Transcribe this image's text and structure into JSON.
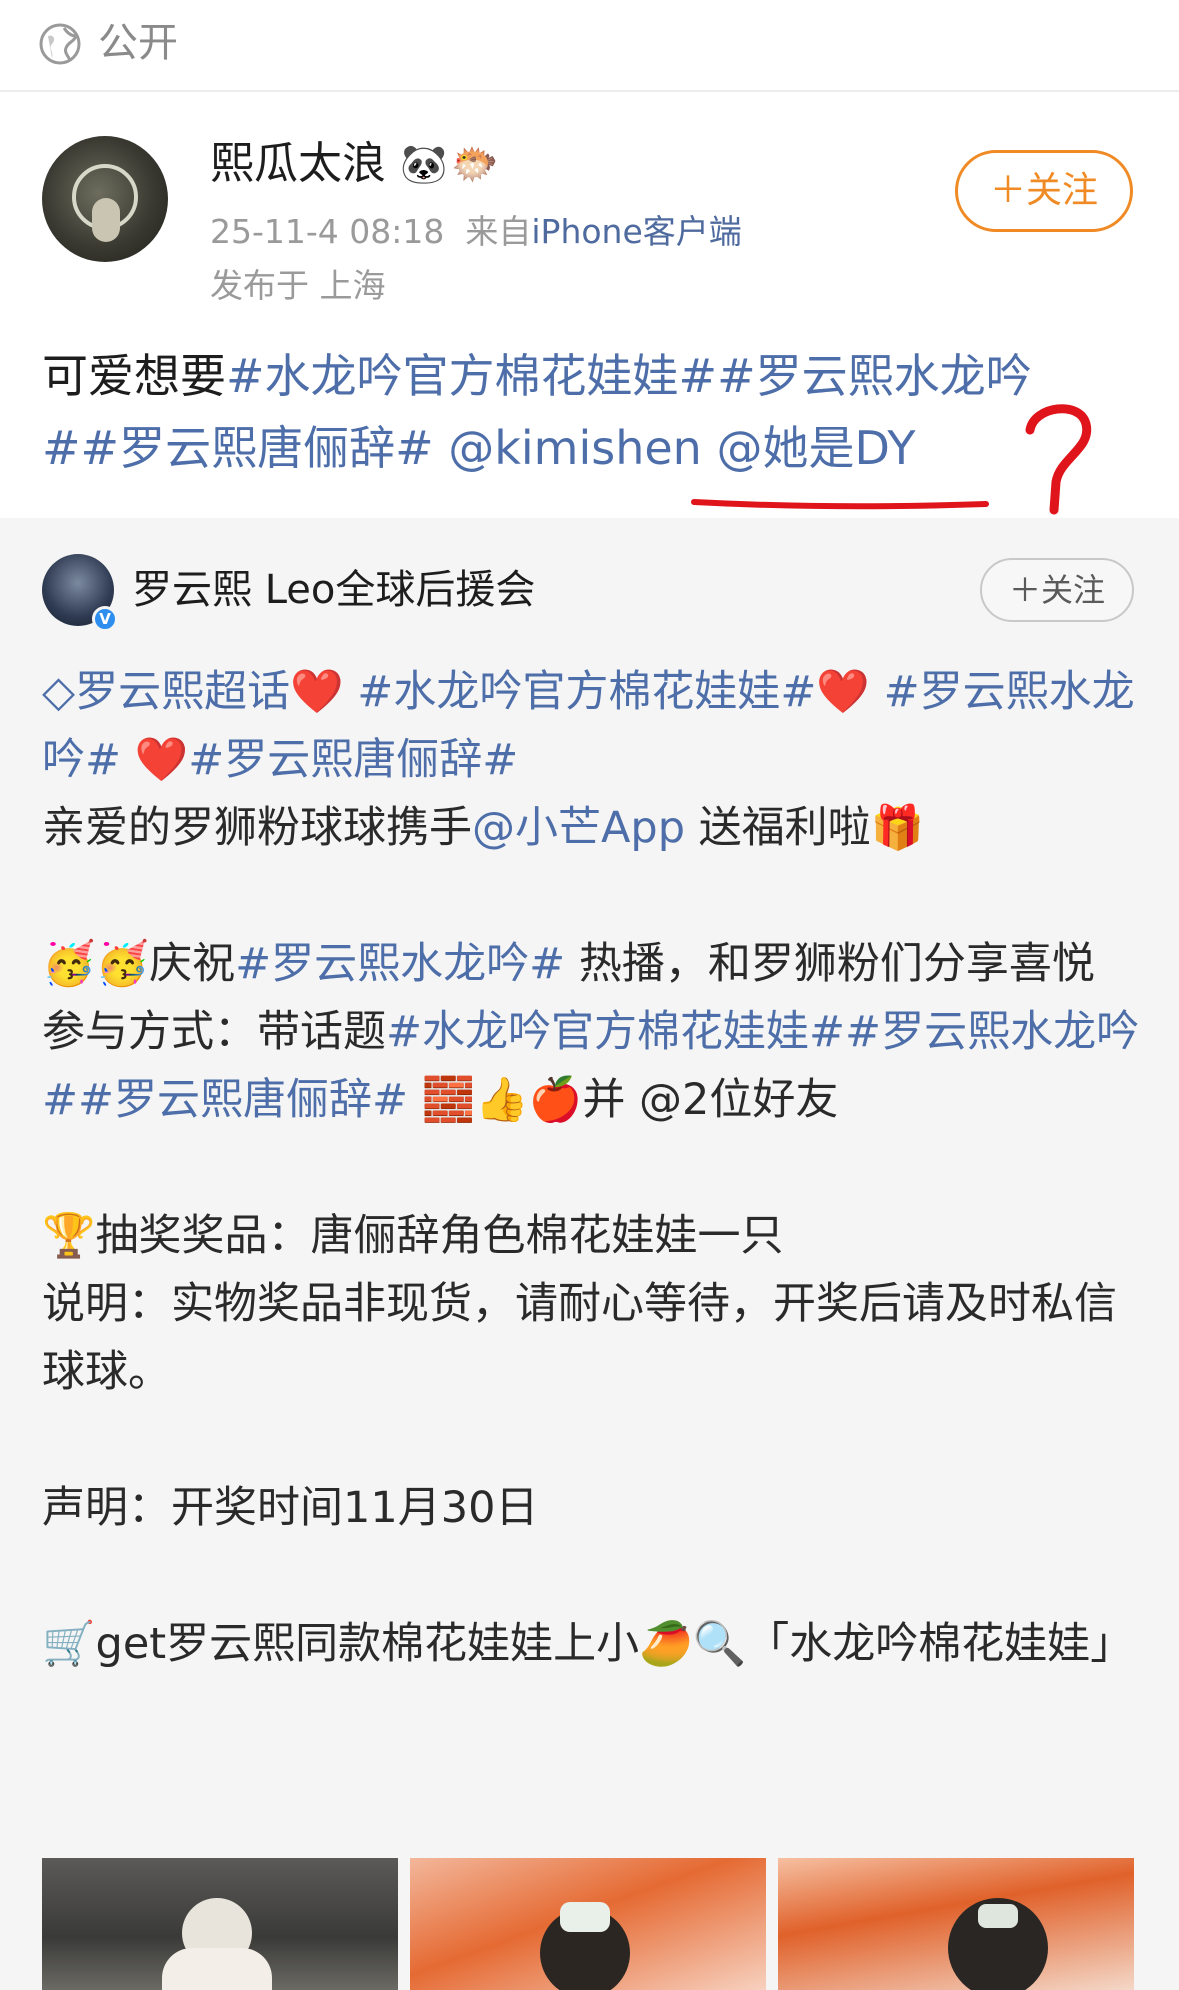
{
  "topbar": {
    "visibility_icon": "globe-icon",
    "visibility_label": "公开"
  },
  "post": {
    "author_name": "熙瓜太浪",
    "name_badges": [
      "🐼",
      "🐡"
    ],
    "timestamp": "25-11-4 08:18",
    "source_prefix": "来自",
    "source_client": "iPhone客户端",
    "location": "发布于 上海",
    "follow_label": "＋关注",
    "text_plain": "可爱想要",
    "text_tags_line1": "#水龙吟官方棉花娃娃##罗云熙水龙吟",
    "text_tags_line2": "##罗云熙唐俪辞# @kimishen @她是DY"
  },
  "annotation": {
    "mark": "?",
    "underline_color": "#e0151b"
  },
  "repost": {
    "author_name": "罗云熙 Leo全球后援会",
    "verified_badge": "V",
    "follow_label": "＋关注",
    "lines": {
      "l1_tag1": "◇罗云熙超话",
      "l1_heart1": "❤️",
      "l1_tag2": " #水龙吟官方棉花娃娃#",
      "l1_heart2": "❤️",
      "l1_tag3": " #罗云熙水龙吟#",
      "l1_heart3": " ❤️",
      "l1_tag4": "#罗云熙唐俪辞#",
      "l2_plain": "亲爱的罗狮粉球球携手",
      "l2_mention": "@小芒App",
      "l2_tail": " 送福利啦🎁",
      "l3_emoji": "🥳🥳",
      "l3_plain1": "庆祝",
      "l3_tag": "#罗云熙水龙吟#",
      "l3_plain2": " 热播，和罗狮粉们分享喜悦",
      "l4_plain": "参与方式：带话题",
      "l4_tags": "#水龙吟官方棉花娃娃##罗云熙水龙吟##罗云熙唐俪辞#",
      "l4_emoji": " 🧱👍🍎",
      "l4_tail": "并 @2位好友",
      "l5": "🏆抽奖奖品：唐俪辞角色棉花娃娃一只",
      "l6": "说明：实物奖品非现货，请耐心等待，开奖后请及时私信球球。",
      "l7": "声明：开奖时间11月30日",
      "l8": "🛒get罗云熙同款棉花娃娃上小🥭🔍「水龙吟棉花娃娃」"
    }
  }
}
